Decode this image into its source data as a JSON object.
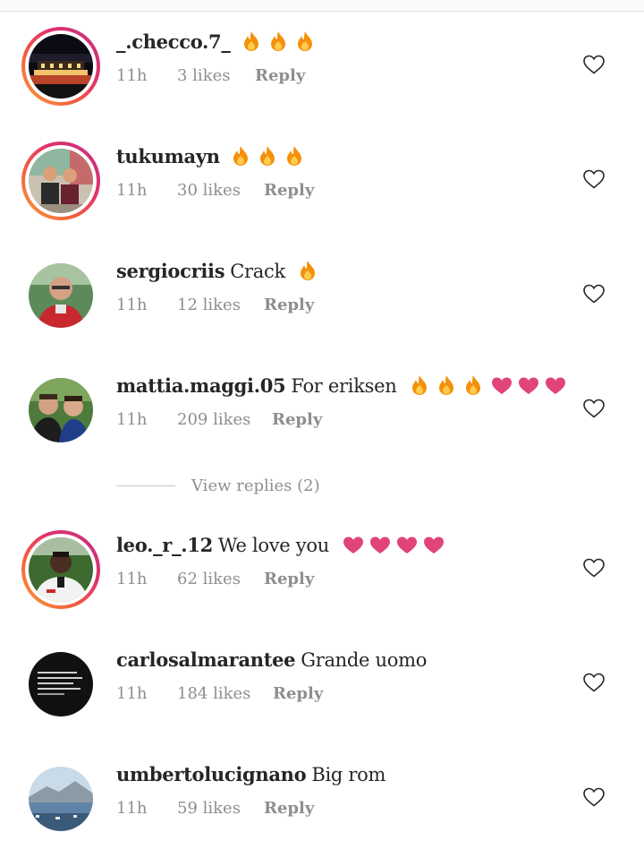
{
  "comments": [
    {
      "username": "_.checco.7_",
      "text": "",
      "emojis": [
        "fire-icon",
        "fire-icon",
        "fire-icon"
      ],
      "time": "11h",
      "likes": "3 likes",
      "reply": "Reply",
      "story_ring": true,
      "avatar": "night-building-photo"
    },
    {
      "username": "tukumayn",
      "text": "",
      "emojis": [
        "fire-icon",
        "fire-icon",
        "fire-icon"
      ],
      "time": "11h",
      "likes": "30 likes",
      "reply": "Reply",
      "story_ring": true,
      "avatar": "two-people-photo"
    },
    {
      "username": "sergiocriis",
      "text": "Crack",
      "emojis": [
        "fire-icon"
      ],
      "time": "11h",
      "likes": "12 likes",
      "reply": "Reply",
      "story_ring": false,
      "avatar": "man-red-shirt-photo"
    },
    {
      "username": "mattia.maggi.05",
      "text": "For eriksen",
      "emojis": [
        "fire-icon",
        "fire-icon",
        "fire-icon",
        "heart-icon",
        "heart-icon",
        "heart-icon"
      ],
      "time": "11h",
      "likes": "209 likes",
      "reply": "Reply",
      "story_ring": false,
      "avatar": "two-men-photo"
    },
    {
      "username": "leo._r_.12",
      "text": "We love you",
      "emojis": [
        "heart-icon",
        "heart-icon",
        "heart-icon",
        "heart-icon"
      ],
      "time": "11h",
      "likes": "62 likes",
      "reply": "Reply",
      "story_ring": true,
      "avatar": "footballer-photo"
    },
    {
      "username": "carlosalmarantee",
      "text": "Grande uomo",
      "emojis": [],
      "time": "11h",
      "likes": "184 likes",
      "reply": "Reply",
      "story_ring": false,
      "avatar": "quote-text-photo"
    },
    {
      "username": "umbertolucignano",
      "text": "Big rom",
      "emojis": [],
      "time": "11h",
      "likes": "59 likes",
      "reply": "Reply",
      "story_ring": false,
      "avatar": "bay-landscape-photo"
    }
  ],
  "view_replies": "View replies (2)",
  "colors": {
    "primary_text": "#262626",
    "secondary_text": "#8e8e8e",
    "fire": "#f4900c",
    "heart_emoji": "#e0447a",
    "story_gradient": [
      "#f9a13a",
      "#e1306c",
      "#c13584"
    ]
  }
}
